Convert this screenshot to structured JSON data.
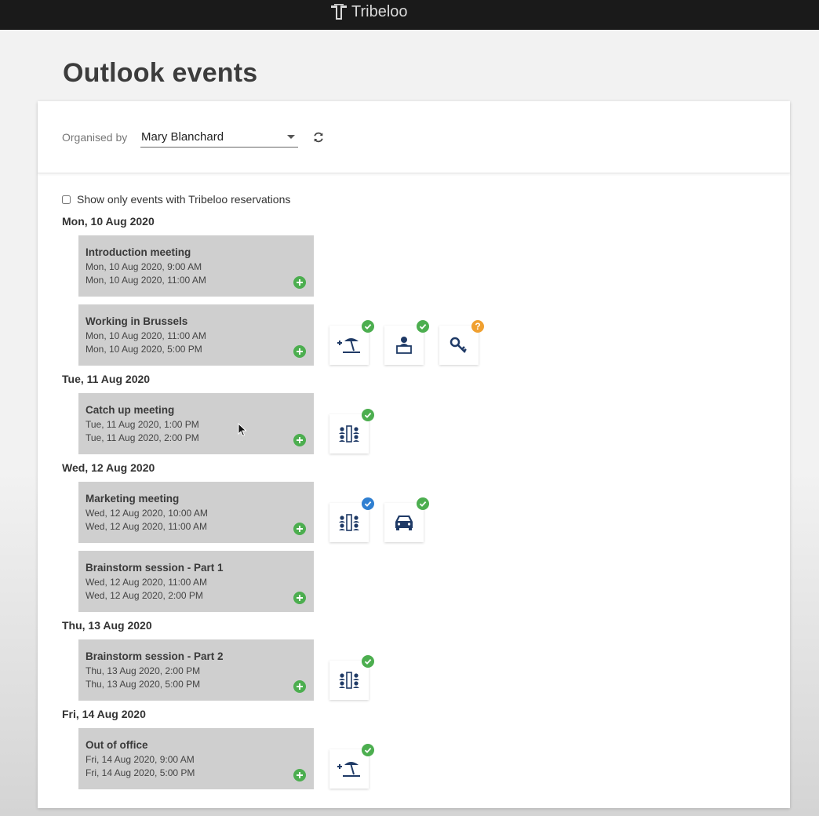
{
  "app": {
    "brand": "Tribeloo"
  },
  "page": {
    "title": "Outlook events"
  },
  "filters": {
    "organised_by_label": "Organised by",
    "organiser": "Mary Blanchard",
    "show_only_label": "Show only events with Tribeloo reservations",
    "show_only_checked": false
  },
  "days": [
    {
      "label": "Mon, 10 Aug 2020",
      "events": [
        {
          "title": "Introduction meeting",
          "start": "Mon, 10 Aug 2020, 9:00 AM",
          "end": "Mon, 10 Aug 2020, 11:00 AM",
          "reservations": []
        },
        {
          "title": "Working in Brussels",
          "start": "Mon, 10 Aug 2020, 11:00 AM",
          "end": "Mon, 10 Aug 2020, 5:00 PM",
          "reservations": [
            {
              "icon": "beach-umbrella-plus-icon",
              "status": "approved"
            },
            {
              "icon": "desk-icon",
              "status": "approved"
            },
            {
              "icon": "key-icon",
              "status": "pending"
            }
          ]
        }
      ]
    },
    {
      "label": "Tue, 11 Aug 2020",
      "events": [
        {
          "title": "Catch up meeting",
          "start": "Tue, 11 Aug 2020, 1:00 PM",
          "end": "Tue, 11 Aug 2020, 2:00 PM",
          "reservations": [
            {
              "icon": "meeting-room-icon",
              "status": "approved"
            }
          ]
        }
      ]
    },
    {
      "label": "Wed, 12 Aug 2020",
      "events": [
        {
          "title": "Marketing meeting",
          "start": "Wed, 12 Aug 2020, 10:00 AM",
          "end": "Wed, 12 Aug 2020, 11:00 AM",
          "reservations": [
            {
              "icon": "meeting-room-icon",
              "status": "confirmed"
            },
            {
              "icon": "car-icon",
              "status": "approved"
            }
          ]
        },
        {
          "title": "Brainstorm session - Part 1",
          "start": "Wed, 12 Aug 2020, 11:00 AM",
          "end": "Wed, 12 Aug 2020, 2:00 PM",
          "reservations": []
        }
      ]
    },
    {
      "label": "Thu, 13 Aug 2020",
      "events": [
        {
          "title": "Brainstorm session - Part 2",
          "start": "Thu, 13 Aug 2020, 2:00 PM",
          "end": "Thu, 13 Aug 2020, 5:00 PM",
          "reservations": [
            {
              "icon": "meeting-room-icon",
              "status": "approved"
            }
          ]
        }
      ]
    },
    {
      "label": "Fri, 14 Aug 2020",
      "events": [
        {
          "title": "Out of office",
          "start": "Fri, 14 Aug 2020, 9:00 AM",
          "end": "Fri, 14 Aug 2020, 5:00 PM",
          "reservations": [
            {
              "icon": "beach-umbrella-plus-icon",
              "status": "approved"
            }
          ]
        }
      ]
    }
  ],
  "colors": {
    "approved": "#4cae4f",
    "confirmed": "#2f7fd1",
    "pending": "#f0a030",
    "icon": "#1f3a66",
    "event_bg": "#cfcfcf"
  }
}
